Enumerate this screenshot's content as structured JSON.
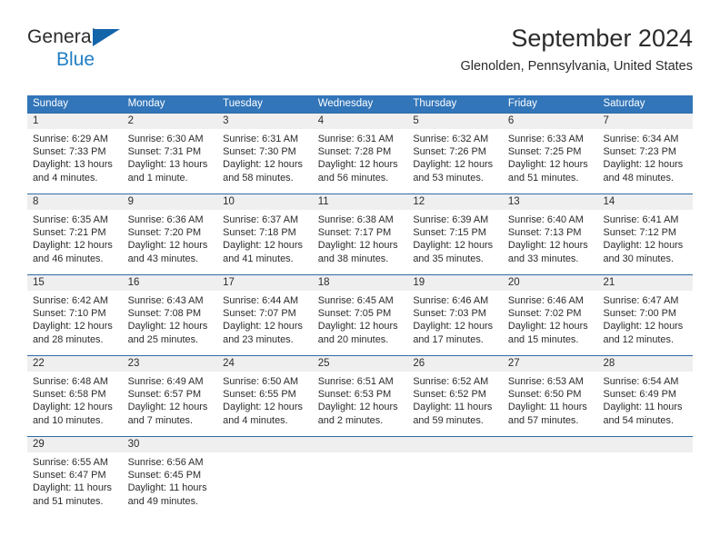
{
  "brand": {
    "line1": "General",
    "line2": "Blue",
    "mark": "triangle-logo",
    "accent_blue": "#1f7ec4",
    "mark_blue": "#1464aa"
  },
  "header": {
    "month_title": "September 2024",
    "location": "Glenolden, Pennsylvania, United States"
  },
  "calendar": {
    "header_bg": "#3275b9",
    "date_strip_bg": "#efefef",
    "rule_color": "#2f6ba8",
    "weekdays": [
      "Sunday",
      "Monday",
      "Tuesday",
      "Wednesday",
      "Thursday",
      "Friday",
      "Saturday"
    ],
    "weeks": [
      {
        "days": [
          {
            "num": "1",
            "sunrise": "Sunrise: 6:29 AM",
            "sunset": "Sunset: 7:33 PM",
            "daylight1": "Daylight: 13 hours",
            "daylight2": "and 4 minutes."
          },
          {
            "num": "2",
            "sunrise": "Sunrise: 6:30 AM",
            "sunset": "Sunset: 7:31 PM",
            "daylight1": "Daylight: 13 hours",
            "daylight2": "and 1 minute."
          },
          {
            "num": "3",
            "sunrise": "Sunrise: 6:31 AM",
            "sunset": "Sunset: 7:30 PM",
            "daylight1": "Daylight: 12 hours",
            "daylight2": "and 58 minutes."
          },
          {
            "num": "4",
            "sunrise": "Sunrise: 6:31 AM",
            "sunset": "Sunset: 7:28 PM",
            "daylight1": "Daylight: 12 hours",
            "daylight2": "and 56 minutes."
          },
          {
            "num": "5",
            "sunrise": "Sunrise: 6:32 AM",
            "sunset": "Sunset: 7:26 PM",
            "daylight1": "Daylight: 12 hours",
            "daylight2": "and 53 minutes."
          },
          {
            "num": "6",
            "sunrise": "Sunrise: 6:33 AM",
            "sunset": "Sunset: 7:25 PM",
            "daylight1": "Daylight: 12 hours",
            "daylight2": "and 51 minutes."
          },
          {
            "num": "7",
            "sunrise": "Sunrise: 6:34 AM",
            "sunset": "Sunset: 7:23 PM",
            "daylight1": "Daylight: 12 hours",
            "daylight2": "and 48 minutes."
          }
        ]
      },
      {
        "days": [
          {
            "num": "8",
            "sunrise": "Sunrise: 6:35 AM",
            "sunset": "Sunset: 7:21 PM",
            "daylight1": "Daylight: 12 hours",
            "daylight2": "and 46 minutes."
          },
          {
            "num": "9",
            "sunrise": "Sunrise: 6:36 AM",
            "sunset": "Sunset: 7:20 PM",
            "daylight1": "Daylight: 12 hours",
            "daylight2": "and 43 minutes."
          },
          {
            "num": "10",
            "sunrise": "Sunrise: 6:37 AM",
            "sunset": "Sunset: 7:18 PM",
            "daylight1": "Daylight: 12 hours",
            "daylight2": "and 41 minutes."
          },
          {
            "num": "11",
            "sunrise": "Sunrise: 6:38 AM",
            "sunset": "Sunset: 7:17 PM",
            "daylight1": "Daylight: 12 hours",
            "daylight2": "and 38 minutes."
          },
          {
            "num": "12",
            "sunrise": "Sunrise: 6:39 AM",
            "sunset": "Sunset: 7:15 PM",
            "daylight1": "Daylight: 12 hours",
            "daylight2": "and 35 minutes."
          },
          {
            "num": "13",
            "sunrise": "Sunrise: 6:40 AM",
            "sunset": "Sunset: 7:13 PM",
            "daylight1": "Daylight: 12 hours",
            "daylight2": "and 33 minutes."
          },
          {
            "num": "14",
            "sunrise": "Sunrise: 6:41 AM",
            "sunset": "Sunset: 7:12 PM",
            "daylight1": "Daylight: 12 hours",
            "daylight2": "and 30 minutes."
          }
        ]
      },
      {
        "days": [
          {
            "num": "15",
            "sunrise": "Sunrise: 6:42 AM",
            "sunset": "Sunset: 7:10 PM",
            "daylight1": "Daylight: 12 hours",
            "daylight2": "and 28 minutes."
          },
          {
            "num": "16",
            "sunrise": "Sunrise: 6:43 AM",
            "sunset": "Sunset: 7:08 PM",
            "daylight1": "Daylight: 12 hours",
            "daylight2": "and 25 minutes."
          },
          {
            "num": "17",
            "sunrise": "Sunrise: 6:44 AM",
            "sunset": "Sunset: 7:07 PM",
            "daylight1": "Daylight: 12 hours",
            "daylight2": "and 23 minutes."
          },
          {
            "num": "18",
            "sunrise": "Sunrise: 6:45 AM",
            "sunset": "Sunset: 7:05 PM",
            "daylight1": "Daylight: 12 hours",
            "daylight2": "and 20 minutes."
          },
          {
            "num": "19",
            "sunrise": "Sunrise: 6:46 AM",
            "sunset": "Sunset: 7:03 PM",
            "daylight1": "Daylight: 12 hours",
            "daylight2": "and 17 minutes."
          },
          {
            "num": "20",
            "sunrise": "Sunrise: 6:46 AM",
            "sunset": "Sunset: 7:02 PM",
            "daylight1": "Daylight: 12 hours",
            "daylight2": "and 15 minutes."
          },
          {
            "num": "21",
            "sunrise": "Sunrise: 6:47 AM",
            "sunset": "Sunset: 7:00 PM",
            "daylight1": "Daylight: 12 hours",
            "daylight2": "and 12 minutes."
          }
        ]
      },
      {
        "days": [
          {
            "num": "22",
            "sunrise": "Sunrise: 6:48 AM",
            "sunset": "Sunset: 6:58 PM",
            "daylight1": "Daylight: 12 hours",
            "daylight2": "and 10 minutes."
          },
          {
            "num": "23",
            "sunrise": "Sunrise: 6:49 AM",
            "sunset": "Sunset: 6:57 PM",
            "daylight1": "Daylight: 12 hours",
            "daylight2": "and 7 minutes."
          },
          {
            "num": "24",
            "sunrise": "Sunrise: 6:50 AM",
            "sunset": "Sunset: 6:55 PM",
            "daylight1": "Daylight: 12 hours",
            "daylight2": "and 4 minutes."
          },
          {
            "num": "25",
            "sunrise": "Sunrise: 6:51 AM",
            "sunset": "Sunset: 6:53 PM",
            "daylight1": "Daylight: 12 hours",
            "daylight2": "and 2 minutes."
          },
          {
            "num": "26",
            "sunrise": "Sunrise: 6:52 AM",
            "sunset": "Sunset: 6:52 PM",
            "daylight1": "Daylight: 11 hours",
            "daylight2": "and 59 minutes."
          },
          {
            "num": "27",
            "sunrise": "Sunrise: 6:53 AM",
            "sunset": "Sunset: 6:50 PM",
            "daylight1": "Daylight: 11 hours",
            "daylight2": "and 57 minutes."
          },
          {
            "num": "28",
            "sunrise": "Sunrise: 6:54 AM",
            "sunset": "Sunset: 6:49 PM",
            "daylight1": "Daylight: 11 hours",
            "daylight2": "and 54 minutes."
          }
        ]
      },
      {
        "days": [
          {
            "num": "29",
            "sunrise": "Sunrise: 6:55 AM",
            "sunset": "Sunset: 6:47 PM",
            "daylight1": "Daylight: 11 hours",
            "daylight2": "and 51 minutes."
          },
          {
            "num": "30",
            "sunrise": "Sunrise: 6:56 AM",
            "sunset": "Sunset: 6:45 PM",
            "daylight1": "Daylight: 11 hours",
            "daylight2": "and 49 minutes."
          },
          {
            "num": "",
            "sunrise": "",
            "sunset": "",
            "daylight1": "",
            "daylight2": ""
          },
          {
            "num": "",
            "sunrise": "",
            "sunset": "",
            "daylight1": "",
            "daylight2": ""
          },
          {
            "num": "",
            "sunrise": "",
            "sunset": "",
            "daylight1": "",
            "daylight2": ""
          },
          {
            "num": "",
            "sunrise": "",
            "sunset": "",
            "daylight1": "",
            "daylight2": ""
          },
          {
            "num": "",
            "sunrise": "",
            "sunset": "",
            "daylight1": "",
            "daylight2": ""
          }
        ]
      }
    ]
  }
}
